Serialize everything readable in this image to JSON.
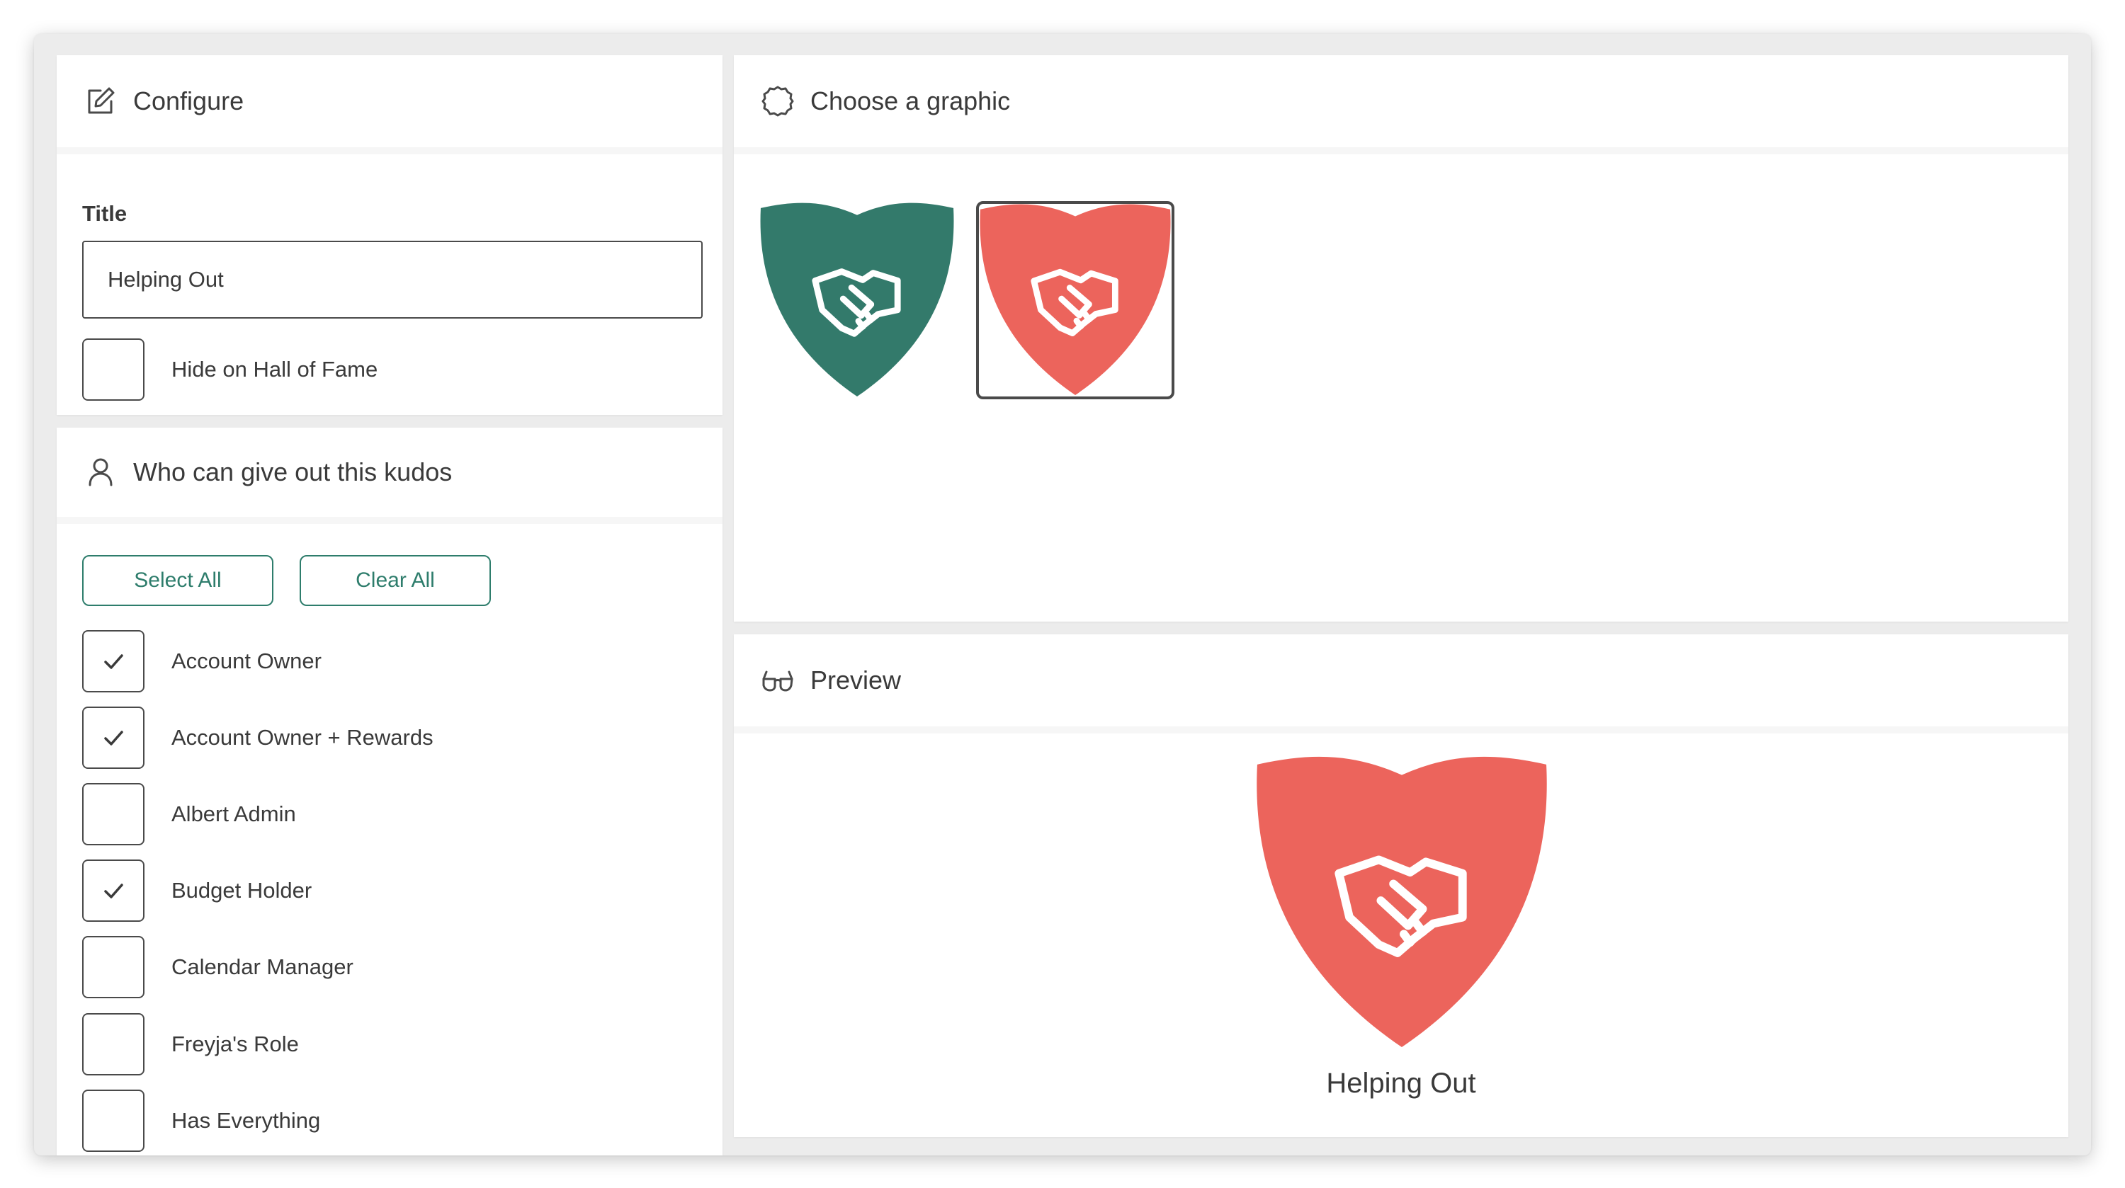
{
  "configure": {
    "header": "Configure",
    "icon": "edit-icon",
    "title_label": "Title",
    "title_value": "Helping Out",
    "hide_label": "Hide on Hall of Fame",
    "hide_checked": false
  },
  "who": {
    "header": "Who can give out this kudos",
    "icon": "user-icon",
    "select_all": "Select All",
    "clear_all": "Clear All",
    "roles": [
      {
        "label": "Account Owner",
        "checked": true
      },
      {
        "label": "Account Owner + Rewards",
        "checked": true
      },
      {
        "label": "Albert Admin",
        "checked": false
      },
      {
        "label": "Budget Holder",
        "checked": true
      },
      {
        "label": "Calendar Manager",
        "checked": false
      },
      {
        "label": "Freyja's Role",
        "checked": false
      },
      {
        "label": "Has Everything",
        "checked": false
      }
    ]
  },
  "graphic": {
    "header": "Choose a graphic",
    "icon": "badge-outline-icon",
    "options": [
      {
        "name": "green-handshake-shield",
        "color": "#337a6b",
        "icon": "handshake-icon",
        "selected": false
      },
      {
        "name": "red-handshake-shield",
        "color": "#ec645c",
        "icon": "handshake-icon",
        "selected": true
      }
    ]
  },
  "preview": {
    "header": "Preview",
    "icon": "glasses-icon",
    "badge_color": "#ec645c",
    "title": "Helping Out"
  },
  "colors": {
    "accent": "#2e7d6c",
    "shield_green": "#337a6b",
    "shield_red": "#ec645c"
  }
}
